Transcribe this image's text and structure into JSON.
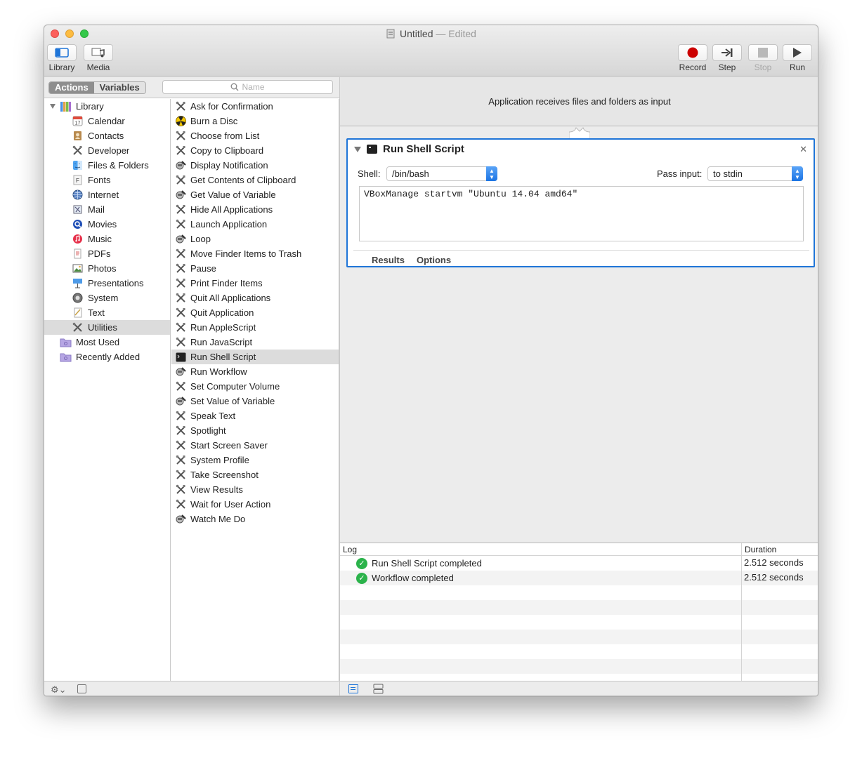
{
  "window": {
    "title": "Untitled",
    "title_separator": "—",
    "status": "Edited"
  },
  "toolbar": {
    "left": [
      {
        "label": "Library",
        "icon": "library-icon"
      },
      {
        "label": "Media",
        "icon": "media-icon"
      }
    ],
    "right": [
      {
        "label": "Record",
        "icon": "record-icon",
        "enabled": true
      },
      {
        "label": "Step",
        "icon": "step-icon",
        "enabled": true
      },
      {
        "label": "Stop",
        "icon": "stop-icon",
        "enabled": false
      },
      {
        "label": "Run",
        "icon": "run-icon",
        "enabled": true
      }
    ]
  },
  "library": {
    "segment_actions": "Actions",
    "segment_variables": "Variables",
    "search_placeholder": "Name",
    "categories": [
      {
        "label": "Library",
        "level": "top",
        "icon": "library-books-icon"
      },
      {
        "label": "Calendar",
        "level": "sub",
        "icon": "calendar-icon"
      },
      {
        "label": "Contacts",
        "level": "sub",
        "icon": "contacts-icon"
      },
      {
        "label": "Developer",
        "level": "sub",
        "icon": "tools-icon"
      },
      {
        "label": "Files & Folders",
        "level": "sub",
        "icon": "finder-icon"
      },
      {
        "label": "Fonts",
        "level": "sub",
        "icon": "fonts-icon"
      },
      {
        "label": "Internet",
        "level": "sub",
        "icon": "globe-icon"
      },
      {
        "label": "Mail",
        "level": "sub",
        "icon": "mail-icon"
      },
      {
        "label": "Movies",
        "level": "sub",
        "icon": "movies-icon"
      },
      {
        "label": "Music",
        "level": "sub",
        "icon": "music-icon"
      },
      {
        "label": "PDFs",
        "level": "sub",
        "icon": "pdf-icon"
      },
      {
        "label": "Photos",
        "level": "sub",
        "icon": "photos-icon"
      },
      {
        "label": "Presentations",
        "level": "sub",
        "icon": "presentation-icon"
      },
      {
        "label": "System",
        "level": "sub",
        "icon": "system-icon"
      },
      {
        "label": "Text",
        "level": "sub",
        "icon": "text-icon"
      },
      {
        "label": "Utilities",
        "level": "sub",
        "icon": "utilities-icon",
        "selected": true
      },
      {
        "label": "Most Used",
        "level": "top",
        "icon": "smart-folder-icon"
      },
      {
        "label": "Recently Added",
        "level": "top",
        "icon": "smart-folder-icon"
      }
    ],
    "actions": [
      {
        "label": "Ask for Confirmation",
        "icon": "tools-icon"
      },
      {
        "label": "Burn a Disc",
        "icon": "burn-icon"
      },
      {
        "label": "Choose from List",
        "icon": "tools-icon"
      },
      {
        "label": "Copy to Clipboard",
        "icon": "tools-icon"
      },
      {
        "label": "Display Notification",
        "icon": "automator-icon"
      },
      {
        "label": "Get Contents of Clipboard",
        "icon": "tools-icon"
      },
      {
        "label": "Get Value of Variable",
        "icon": "automator-icon"
      },
      {
        "label": "Hide All Applications",
        "icon": "tools-icon"
      },
      {
        "label": "Launch Application",
        "icon": "tools-icon"
      },
      {
        "label": "Loop",
        "icon": "automator-icon"
      },
      {
        "label": "Move Finder Items to Trash",
        "icon": "tools-icon"
      },
      {
        "label": "Pause",
        "icon": "tools-icon"
      },
      {
        "label": "Print Finder Items",
        "icon": "tools-icon"
      },
      {
        "label": "Quit All Applications",
        "icon": "tools-icon"
      },
      {
        "label": "Quit Application",
        "icon": "tools-icon"
      },
      {
        "label": "Run AppleScript",
        "icon": "tools-icon"
      },
      {
        "label": "Run JavaScript",
        "icon": "tools-icon"
      },
      {
        "label": "Run Shell Script",
        "icon": "terminal-icon",
        "selected": true
      },
      {
        "label": "Run Workflow",
        "icon": "automator-icon"
      },
      {
        "label": "Set Computer Volume",
        "icon": "tools-icon"
      },
      {
        "label": "Set Value of Variable",
        "icon": "automator-icon"
      },
      {
        "label": "Speak Text",
        "icon": "tools-icon"
      },
      {
        "label": "Spotlight",
        "icon": "tools-icon"
      },
      {
        "label": "Start Screen Saver",
        "icon": "tools-icon"
      },
      {
        "label": "System Profile",
        "icon": "tools-icon"
      },
      {
        "label": "Take Screenshot",
        "icon": "tools-icon"
      },
      {
        "label": "View Results",
        "icon": "tools-icon"
      },
      {
        "label": "Wait for User Action",
        "icon": "tools-icon"
      },
      {
        "label": "Watch Me Do",
        "icon": "automator-icon"
      }
    ]
  },
  "workflow": {
    "input_banner": "Application receives files and folders as input",
    "action": {
      "name": "Run Shell Script",
      "shell_label": "Shell:",
      "shell_value": "/bin/bash",
      "pass_input_label": "Pass input:",
      "pass_input_value": "to stdin",
      "script": "VBoxManage startvm \"Ubuntu 14.04 amd64\"",
      "tab_results": "Results",
      "tab_options": "Options"
    }
  },
  "log": {
    "col_log": "Log",
    "col_duration": "Duration",
    "entries": [
      {
        "message": "Run Shell Script completed",
        "duration": "2.512 seconds"
      },
      {
        "message": "Workflow completed",
        "duration": "2.512 seconds"
      }
    ]
  },
  "colors": {
    "accent": "#1f75d8",
    "record": "#cc0000",
    "success": "#2bb34b"
  }
}
